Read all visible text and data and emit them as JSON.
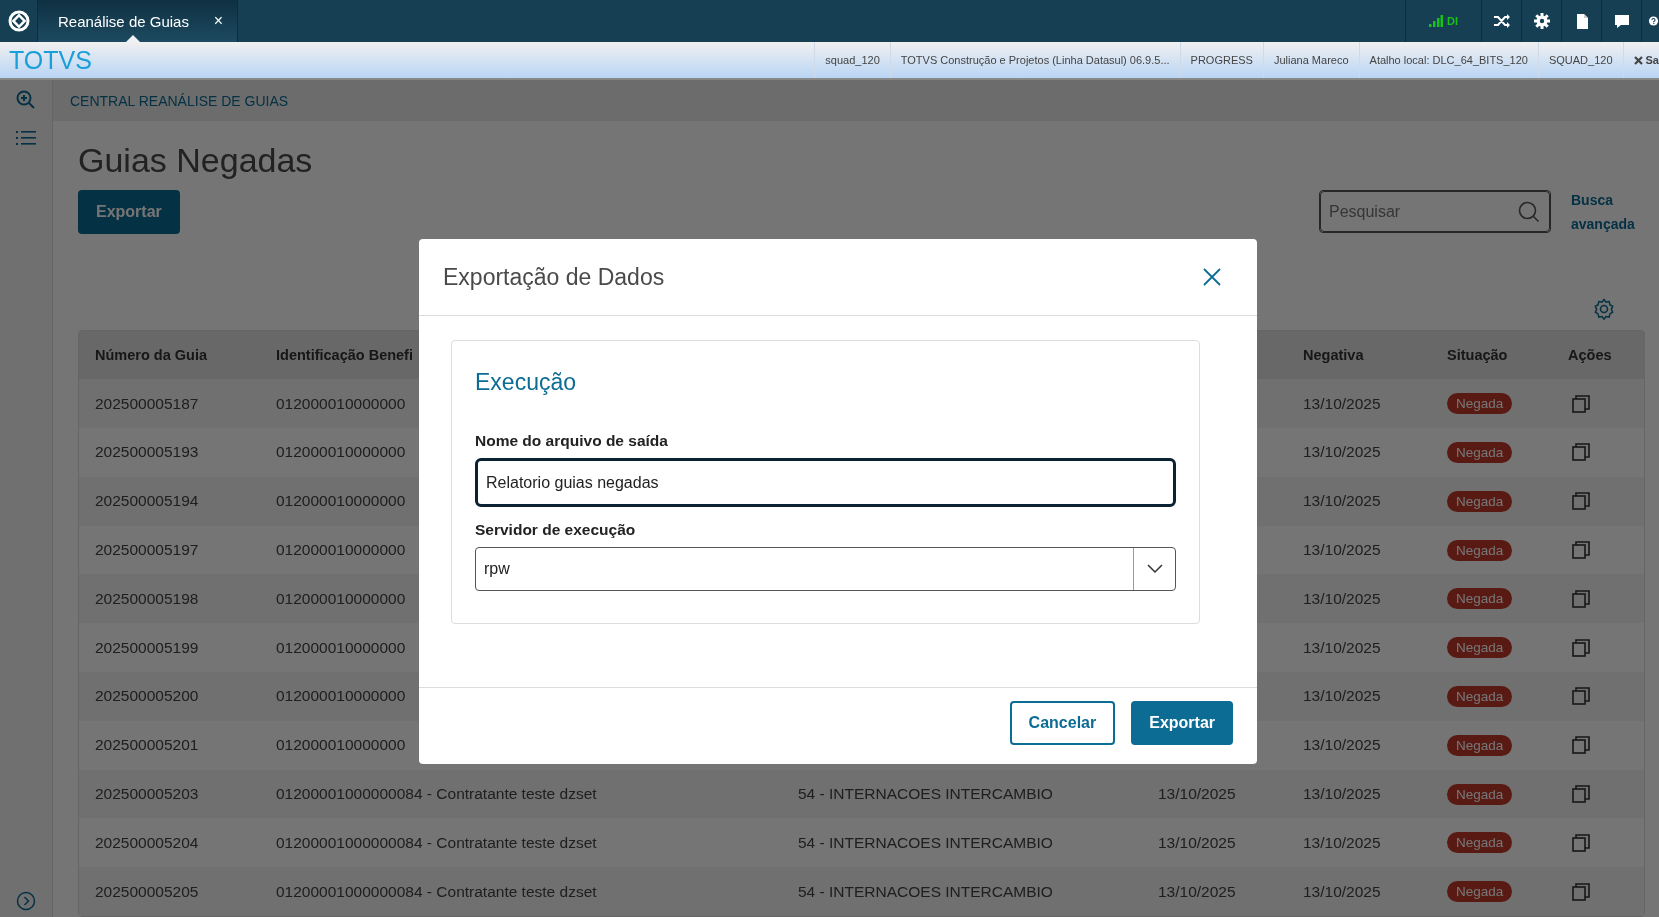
{
  "top_bar": {
    "tab": {
      "label": "Reanálise de Guias",
      "close": "×",
      "selected": true
    },
    "signal_label": "DI"
  },
  "info_bar": {
    "brand": "TOTVS",
    "items": [
      "squad_120",
      "TOTVS Construção e Projetos (Linha Datasul) 06.9.5...",
      "PROGRESS",
      "Juliana Mareco",
      "Atalho local: DLC_64_BITS_120",
      "SQUAD_120"
    ],
    "exit_label": "Sa"
  },
  "page": {
    "breadcrumb": "CENTRAL REANÁLISE DE GUIAS",
    "title": "Guias Negadas",
    "export_button": "Exportar",
    "search": {
      "placeholder": "Pesquisar"
    },
    "advanced_search": "Busca avançada"
  },
  "table": {
    "columns": {
      "guia": "Número da Guia",
      "beneficiario": "Identificação Benefi",
      "negativa": "Negativa",
      "situacao": "Situação",
      "acoes": "Ações"
    },
    "rows": [
      {
        "guia": "202500005187",
        "beneficiario": "012000010000000",
        "negativa": "13/10/2025",
        "situacao": "Negada"
      },
      {
        "guia": "202500005193",
        "beneficiario": "012000010000000",
        "negativa": "13/10/2025",
        "situacao": "Negada"
      },
      {
        "guia": "202500005194",
        "beneficiario": "012000010000000",
        "negativa": "13/10/2025",
        "situacao": "Negada"
      },
      {
        "guia": "202500005197",
        "beneficiario": "012000010000000",
        "negativa": "13/10/2025",
        "situacao": "Negada"
      },
      {
        "guia": "202500005198",
        "beneficiario": "012000010000000",
        "negativa": "13/10/2025",
        "situacao": "Negada"
      },
      {
        "guia": "202500005199",
        "beneficiario": "012000010000000",
        "negativa": "13/10/2025",
        "situacao": "Negada"
      },
      {
        "guia": "202500005200",
        "beneficiario": "012000010000000",
        "negativa": "13/10/2025",
        "situacao": "Negada"
      },
      {
        "guia": "202500005201",
        "beneficiario": "012000010000000",
        "negativa": "13/10/2025",
        "situacao": "Negada"
      },
      {
        "guia": "202500005203",
        "beneficiario": "01200001000000084 - Contratante teste dzset",
        "column_3": "54 - INTERNACOES INTERCAMBIO",
        "column_4": "13/10/2025",
        "negativa": "13/10/2025",
        "situacao": "Negada"
      },
      {
        "guia": "202500005204",
        "beneficiario": "01200001000000084 - Contratante teste dzset",
        "column_3": "54 - INTERNACOES INTERCAMBIO",
        "column_4": "13/10/2025",
        "negativa": "13/10/2025",
        "situacao": "Negada"
      },
      {
        "guia": "202500005205",
        "beneficiario": "01200001000000084 - Contratante teste dzset",
        "column_3": "54 - INTERNACOES INTERCAMBIO",
        "column_4": "13/10/2025",
        "negativa": "13/10/2025",
        "situacao": "Negada"
      }
    ]
  },
  "modal": {
    "title": "Exportação de Dados",
    "section_title": "Execução",
    "file_label": "Nome do arquivo de saída",
    "file_value": "Relatorio guias negadas",
    "server_label": "Servidor de execução",
    "server_value": "rpw",
    "cancel_button": "Cancelar",
    "export_button": "Exportar"
  }
}
